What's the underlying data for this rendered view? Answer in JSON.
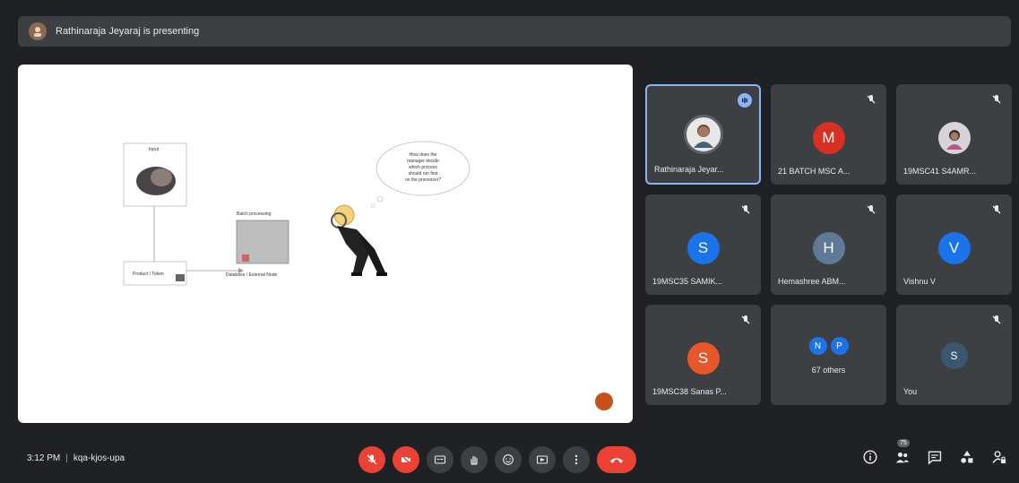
{
  "banner": {
    "text": "Rathinaraja Jeyaraj is presenting"
  },
  "slide": {
    "box_top_label": "Input",
    "box_bottom_label": "Product / Token",
    "box_middle_title": "Batch processing",
    "arrow_label": "Database / External Node",
    "speech_lines": [
      "How does the",
      "manager decide",
      "which process",
      "should run first",
      "on the processor?"
    ],
    "page_dot_color": "#c5501c"
  },
  "tiles": [
    {
      "name": "Rathinaraja Jeyar...",
      "type": "photo",
      "active": true,
      "badge": "speaking-icon"
    },
    {
      "name": "21 BATCH MSC A...",
      "type": "letter",
      "letter": "M",
      "color": "#d93025",
      "muted": true
    },
    {
      "name": "19MSC41 S4AMR...",
      "type": "photo2",
      "muted": true
    },
    {
      "name": "19MSC35 SAMIK...",
      "type": "letter",
      "letter": "S",
      "color": "#1a73e8",
      "muted": true
    },
    {
      "name": "Hemashree ABM...",
      "type": "letter",
      "letter": "H",
      "color": "#5f7a99",
      "muted": true
    },
    {
      "name": "Vishnu V",
      "type": "letter",
      "letter": "V",
      "color": "#1a73e8",
      "muted": true
    },
    {
      "name": "19MSC38 Sanas P...",
      "type": "letter",
      "letter": "S",
      "color": "#e8572a",
      "muted": true
    },
    {
      "name": "67 others",
      "type": "others",
      "initials": [
        "N",
        "P"
      ]
    },
    {
      "name": "You",
      "type": "letter",
      "letter": "S",
      "color": "#3b5670",
      "muted": true
    }
  ],
  "bottom": {
    "time": "3:12 PM",
    "meeting_code": "kqa-kjos-upa",
    "participant_count": "75"
  },
  "colors": {
    "accent": "#8ab4f8",
    "danger": "#ea4335",
    "surface": "#3c4043",
    "background": "#202124"
  }
}
